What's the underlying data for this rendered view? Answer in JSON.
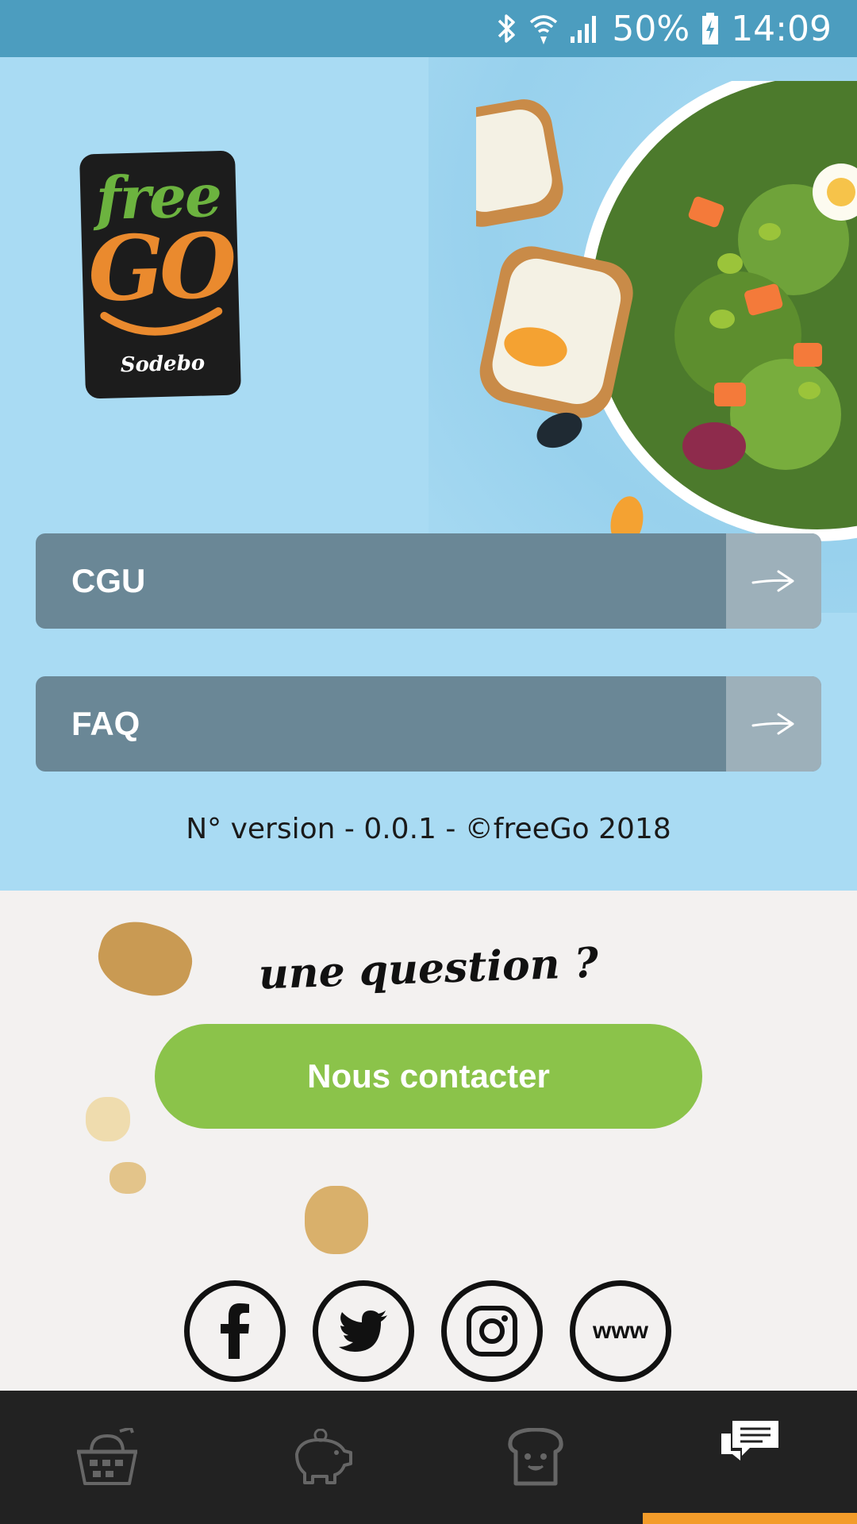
{
  "status_bar": {
    "battery": "50%",
    "time": "14:09",
    "icons": [
      "bluetooth-icon",
      "wifi-icon",
      "signal-icon",
      "battery-charging-icon"
    ]
  },
  "logo": {
    "line1": "free",
    "line2": "GO",
    "brand": "Sodebo"
  },
  "menu": {
    "items": [
      {
        "label": "CGU",
        "icon": "arrow-right-icon"
      },
      {
        "label": "FAQ",
        "icon": "arrow-right-icon"
      }
    ]
  },
  "version_text": "N° version - 0.0.1 - ©freeGo 2018",
  "contact": {
    "question": "une question ?",
    "button_label": "Nous contacter"
  },
  "socials": [
    {
      "name": "facebook",
      "icon": "facebook-icon"
    },
    {
      "name": "twitter",
      "icon": "twitter-icon"
    },
    {
      "name": "instagram",
      "icon": "instagram-icon"
    },
    {
      "name": "website",
      "icon": "www-icon",
      "label": "www"
    }
  ],
  "bottom_nav": {
    "items": [
      "basket-icon",
      "piggy-bank-icon",
      "toast-icon",
      "chat-icon"
    ],
    "active_index": 3
  },
  "colors": {
    "status_bar": "#4c9dbf",
    "hero_bg": "#a9dbf3",
    "menu_button": "#6a8796",
    "menu_arrow_bg": "#9db0ba",
    "contact_button": "#8bc34a",
    "nav_bg": "#222222",
    "nav_active": "#f39c2a",
    "logo_green": "#6cb33f",
    "logo_orange": "#ea8a2e"
  }
}
